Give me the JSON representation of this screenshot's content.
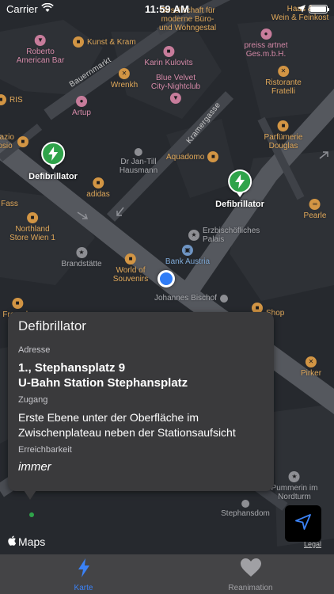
{
  "status_bar": {
    "carrier": "Carrier",
    "time": "11:59 AM"
  },
  "map": {
    "streets": [
      "Bauernmarkt",
      "Kramergasse"
    ],
    "pois": [
      {
        "name": "Kunst & Kram",
        "color": "#d29544",
        "icon": "bag-icon"
      },
      {
        "name": "Roberto\nAmerican Bar",
        "color": "#d58aa8",
        "icon": "glass-icon"
      },
      {
        "name": "Karin Kulovits",
        "color": "#d58aa8",
        "icon": "bag-icon"
      },
      {
        "name": "Wrenkh",
        "color": "#d29544",
        "icon": "fork-icon"
      },
      {
        "name": "Blue Velvet\nCity-Nightclub",
        "color": "#d58aa8",
        "icon": "glass-icon"
      },
      {
        "name": "Artup",
        "color": "#d58aa8",
        "icon": "camera-icon"
      },
      {
        "name": "Ristorante\nFratelli",
        "color": "#d29544",
        "icon": "fork-icon"
      },
      {
        "name": "Parfümerie\nDouglas",
        "color": "#d29544",
        "icon": "bag-icon"
      },
      {
        "name": "Aquadomo",
        "color": "#d29544",
        "icon": "bag-icon"
      },
      {
        "name": "Dr Jan-Till\nHausmann",
        "color": "#8d8e93",
        "icon": "dot-icon"
      },
      {
        "name": "adidas",
        "color": "#d29544",
        "icon": "bag-icon"
      },
      {
        "name": "Pearle",
        "color": "#d29544",
        "icon": "glasses-icon"
      },
      {
        "name": "Northland\nStore Wien 1",
        "color": "#d29544",
        "icon": "bag-icon"
      },
      {
        "name": "Erzbischöfliches\nPalais",
        "color": "#8d8e93",
        "icon": "star-icon"
      },
      {
        "name": "Brandstätte",
        "color": "#8d8e93",
        "icon": "star-icon"
      },
      {
        "name": "World of\nSouvenirs",
        "color": "#d29544",
        "icon": "bag-icon"
      },
      {
        "name": "Bank Austria",
        "color": "#6f95c4",
        "icon": "bank-icon"
      },
      {
        "name": "Johannes Bischof",
        "color": "#8d8e93",
        "icon": "dot-icon"
      },
      {
        "name": "Pirker",
        "color": "#d29544",
        "icon": "fork-icon"
      },
      {
        "name": "Pummerin im\nNordturm",
        "color": "#8d8e93",
        "icon": "star-icon"
      },
      {
        "name": "Stephansdom",
        "color": "#8d8e93",
        "icon": "dot-icon"
      },
      {
        "name": "preiss artnet\nGes.m.b.H.",
        "color": "#d58aa8",
        "icon": "camera-icon"
      },
      {
        "name": "Haas &\nWein & Feinkost",
        "color": "#d29544",
        "icon": "bag-icon"
      },
      {
        "name": "Gesellschaft für\nmoderne Büro-\nund Wohngestal",
        "color": "#d29544",
        "icon": "bag-icon"
      },
      {
        "name": "RIS",
        "color": "#d29544",
        "icon": "bag-icon"
      },
      {
        "name": "pazio\nrosio",
        "color": "#d29544",
        "icon": "bag-icon"
      },
      {
        "name": "Fass",
        "color": "#d29544",
        "icon": "glass-icon"
      },
      {
        "name": "Freunde",
        "color": "#d29544",
        "icon": "bag-icon"
      },
      {
        "name": "Shop",
        "color": "#d29544",
        "icon": "bag-icon"
      }
    ],
    "pins": [
      {
        "label": "Defibrillator"
      },
      {
        "label": "Defibrillator"
      }
    ],
    "attribution": "Maps",
    "legal": "Legal"
  },
  "callout": {
    "title": "Defibrillator",
    "address_label": "Adresse",
    "address_line1": "1., Stephansplatz 9",
    "address_line2": "U-Bahn Station Stephansplatz",
    "access_label": "Zugang",
    "access_text": "Erste Ebene unter der Oberfläche im Zwischenplateau neben der Stationsaufsicht",
    "availability_label": "Erreichbarkeit",
    "availability_text": "immer"
  },
  "tabs": [
    {
      "label": "Karte",
      "icon": "bolt-icon",
      "active": true
    },
    {
      "label": "Reanimation",
      "icon": "heart-icon",
      "active": false
    }
  ],
  "colors": {
    "accent": "#3b82f6",
    "pin": "#2fa34a",
    "user_location": "#2f7cf6"
  }
}
